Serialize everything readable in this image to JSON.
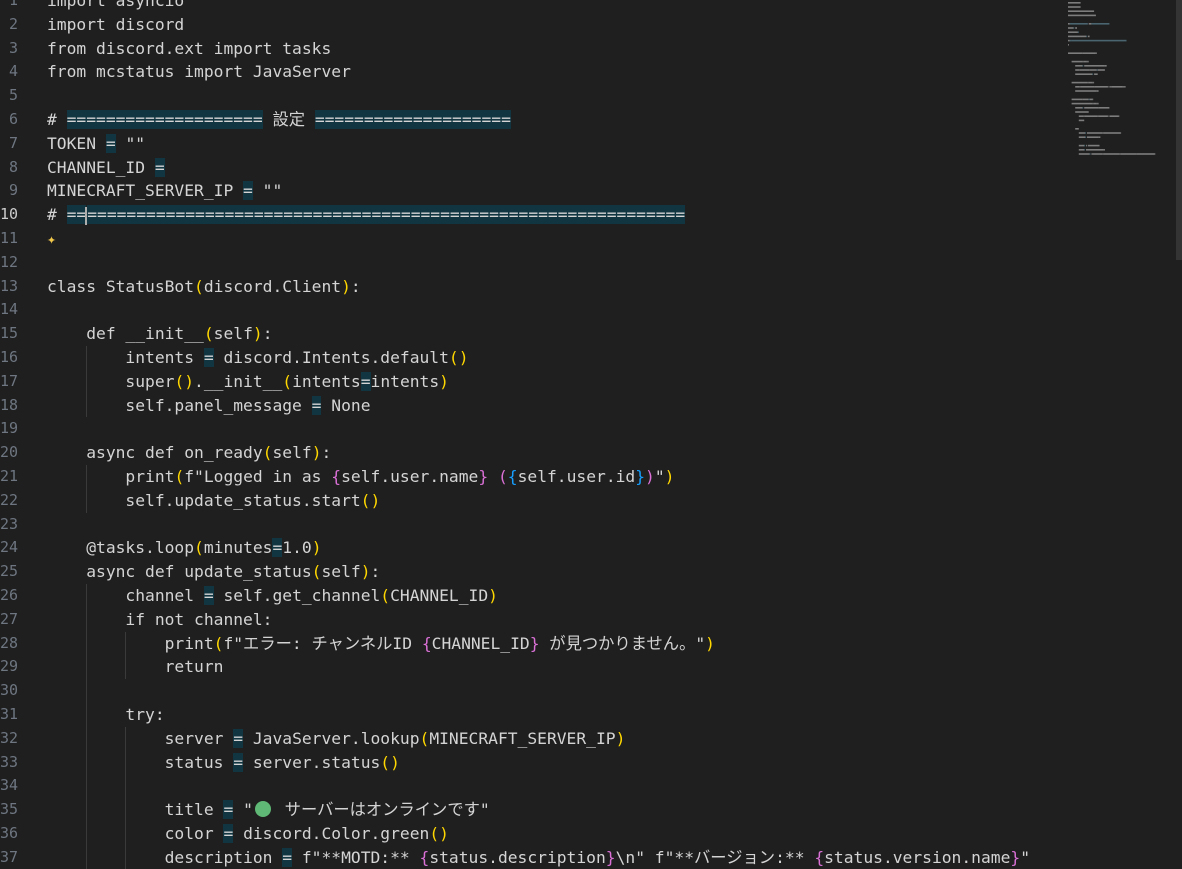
{
  "editor": {
    "active_line": "10",
    "lines": [
      {
        "n": "1",
        "parts": [
          [
            "t",
            "import asyncio"
          ]
        ]
      },
      {
        "n": "2",
        "parts": [
          [
            "t",
            "import discord"
          ]
        ]
      },
      {
        "n": "3",
        "parts": [
          [
            "t",
            "from discord.ext import tasks"
          ]
        ]
      },
      {
        "n": "4",
        "parts": [
          [
            "t",
            "from mcstatus import JavaServer"
          ]
        ]
      },
      {
        "n": "5",
        "parts": []
      },
      {
        "n": "6",
        "parts": [
          [
            "t",
            "# "
          ],
          [
            "hl",
            "===================="
          ],
          [
            "t",
            " 設定 "
          ],
          [
            "hl",
            "===================="
          ]
        ]
      },
      {
        "n": "7",
        "parts": [
          [
            "t",
            "TOKEN "
          ],
          [
            "hl",
            "="
          ],
          [
            "t",
            " \"\""
          ]
        ]
      },
      {
        "n": "8",
        "parts": [
          [
            "t",
            "CHANNEL_ID "
          ],
          [
            "hl",
            "="
          ]
        ]
      },
      {
        "n": "9",
        "parts": [
          [
            "t",
            "MINECRAFT_SERVER_IP "
          ],
          [
            "hl",
            "="
          ],
          [
            "t",
            " \"\""
          ]
        ]
      },
      {
        "n": "10",
        "parts": [
          [
            "t",
            "# "
          ],
          [
            "hl",
            "=="
          ],
          [
            "cursor",
            ""
          ],
          [
            "hl",
            "============================================================="
          ]
        ]
      },
      {
        "n": "11",
        "parts": [
          [
            "sparkle",
            "✦"
          ]
        ]
      },
      {
        "n": "12",
        "parts": []
      },
      {
        "n": "13",
        "parts": [
          [
            "t",
            "class StatusBot"
          ],
          [
            "b1",
            "("
          ],
          [
            "t",
            "discord.Client"
          ],
          [
            "b1",
            ")"
          ],
          [
            "t",
            ":"
          ]
        ]
      },
      {
        "n": "14",
        "parts": []
      },
      {
        "n": "15",
        "parts": [
          [
            "t",
            "    def __init__"
          ],
          [
            "b1",
            "("
          ],
          [
            "t",
            "self"
          ],
          [
            "b1",
            ")"
          ],
          [
            "t",
            ":"
          ]
        ]
      },
      {
        "n": "16",
        "parts": [
          [
            "t",
            "        intents "
          ],
          [
            "hl",
            "="
          ],
          [
            "t",
            " discord.Intents.default"
          ],
          [
            "b1",
            "()"
          ]
        ]
      },
      {
        "n": "17",
        "parts": [
          [
            "t",
            "        super"
          ],
          [
            "b1",
            "()"
          ],
          [
            "t",
            ".__init__"
          ],
          [
            "b1",
            "("
          ],
          [
            "t",
            "intents"
          ],
          [
            "hl",
            "="
          ],
          [
            "t",
            "intents"
          ],
          [
            "b1",
            ")"
          ]
        ]
      },
      {
        "n": "18",
        "parts": [
          [
            "t",
            "        self.panel_message "
          ],
          [
            "hl",
            "="
          ],
          [
            "t",
            " None"
          ]
        ]
      },
      {
        "n": "19",
        "parts": []
      },
      {
        "n": "20",
        "parts": [
          [
            "t",
            "    async def on_ready"
          ],
          [
            "b1",
            "("
          ],
          [
            "t",
            "self"
          ],
          [
            "b1",
            ")"
          ],
          [
            "t",
            ":"
          ]
        ]
      },
      {
        "n": "21",
        "parts": [
          [
            "t",
            "        print"
          ],
          [
            "b1",
            "("
          ],
          [
            "t",
            "f\"Logged in as "
          ],
          [
            "b2",
            "{"
          ],
          [
            "t",
            "self.user.name"
          ],
          [
            "b2",
            "}"
          ],
          [
            "t",
            " "
          ],
          [
            "b2",
            "("
          ],
          [
            "b3",
            "{"
          ],
          [
            "t",
            "self.user.id"
          ],
          [
            "b3",
            "}"
          ],
          [
            "b2",
            ")"
          ],
          [
            "t",
            "\""
          ],
          [
            "b1",
            ")"
          ]
        ]
      },
      {
        "n": "22",
        "parts": [
          [
            "t",
            "        self.update_status.start"
          ],
          [
            "b1",
            "()"
          ]
        ]
      },
      {
        "n": "23",
        "parts": []
      },
      {
        "n": "24",
        "parts": [
          [
            "t",
            "    @tasks.loop"
          ],
          [
            "b1",
            "("
          ],
          [
            "t",
            "minutes"
          ],
          [
            "hl",
            "="
          ],
          [
            "t",
            "1.0"
          ],
          [
            "b1",
            ")"
          ]
        ]
      },
      {
        "n": "25",
        "parts": [
          [
            "t",
            "    async def update_status"
          ],
          [
            "b1",
            "("
          ],
          [
            "t",
            "self"
          ],
          [
            "b1",
            ")"
          ],
          [
            "t",
            ":"
          ]
        ]
      },
      {
        "n": "26",
        "parts": [
          [
            "t",
            "        channel "
          ],
          [
            "hl",
            "="
          ],
          [
            "t",
            " self.get_channel"
          ],
          [
            "b1",
            "("
          ],
          [
            "t",
            "CHANNEL_ID"
          ],
          [
            "b1",
            ")"
          ]
        ]
      },
      {
        "n": "27",
        "parts": [
          [
            "t",
            "        if not channel:"
          ]
        ]
      },
      {
        "n": "28",
        "parts": [
          [
            "t",
            "            print"
          ],
          [
            "b1",
            "("
          ],
          [
            "t",
            "f\"エラー: チャンネルID "
          ],
          [
            "b2",
            "{"
          ],
          [
            "t",
            "CHANNEL_ID"
          ],
          [
            "b2",
            "}"
          ],
          [
            "t",
            " が見つかりません。\""
          ],
          [
            "b1",
            ")"
          ]
        ]
      },
      {
        "n": "29",
        "parts": [
          [
            "t",
            "            return"
          ]
        ]
      },
      {
        "n": "30",
        "parts": []
      },
      {
        "n": "31",
        "parts": [
          [
            "t",
            "        try:"
          ]
        ]
      },
      {
        "n": "32",
        "parts": [
          [
            "t",
            "            server "
          ],
          [
            "hl",
            "="
          ],
          [
            "t",
            " JavaServer.lookup"
          ],
          [
            "b1",
            "("
          ],
          [
            "t",
            "MINECRAFT_SERVER_IP"
          ],
          [
            "b1",
            ")"
          ]
        ]
      },
      {
        "n": "33",
        "parts": [
          [
            "t",
            "            status "
          ],
          [
            "hl",
            "="
          ],
          [
            "t",
            " server.status"
          ],
          [
            "b1",
            "()"
          ]
        ]
      },
      {
        "n": "34",
        "parts": []
      },
      {
        "n": "35",
        "parts": [
          [
            "t",
            "            title "
          ],
          [
            "hl",
            "="
          ],
          [
            "t",
            " \""
          ],
          [
            "dot",
            ""
          ],
          [
            "t",
            " サーバーはオンラインです\""
          ]
        ]
      },
      {
        "n": "36",
        "parts": [
          [
            "t",
            "            color "
          ],
          [
            "hl",
            "="
          ],
          [
            "t",
            " discord.Color.green"
          ],
          [
            "b1",
            "()"
          ]
        ]
      },
      {
        "n": "37",
        "parts": [
          [
            "t",
            "            description "
          ],
          [
            "hl",
            "="
          ],
          [
            "t",
            " f\"**MOTD:** "
          ],
          [
            "b2",
            "{"
          ],
          [
            "t",
            "status.description"
          ],
          [
            "b2",
            "}"
          ],
          [
            "t",
            "\\n\" f\"**バージョン:** "
          ],
          [
            "b2",
            "{"
          ],
          [
            "t",
            "status.version.name"
          ],
          [
            "b2",
            "}"
          ],
          [
            "t",
            "\""
          ]
        ]
      }
    ]
  }
}
